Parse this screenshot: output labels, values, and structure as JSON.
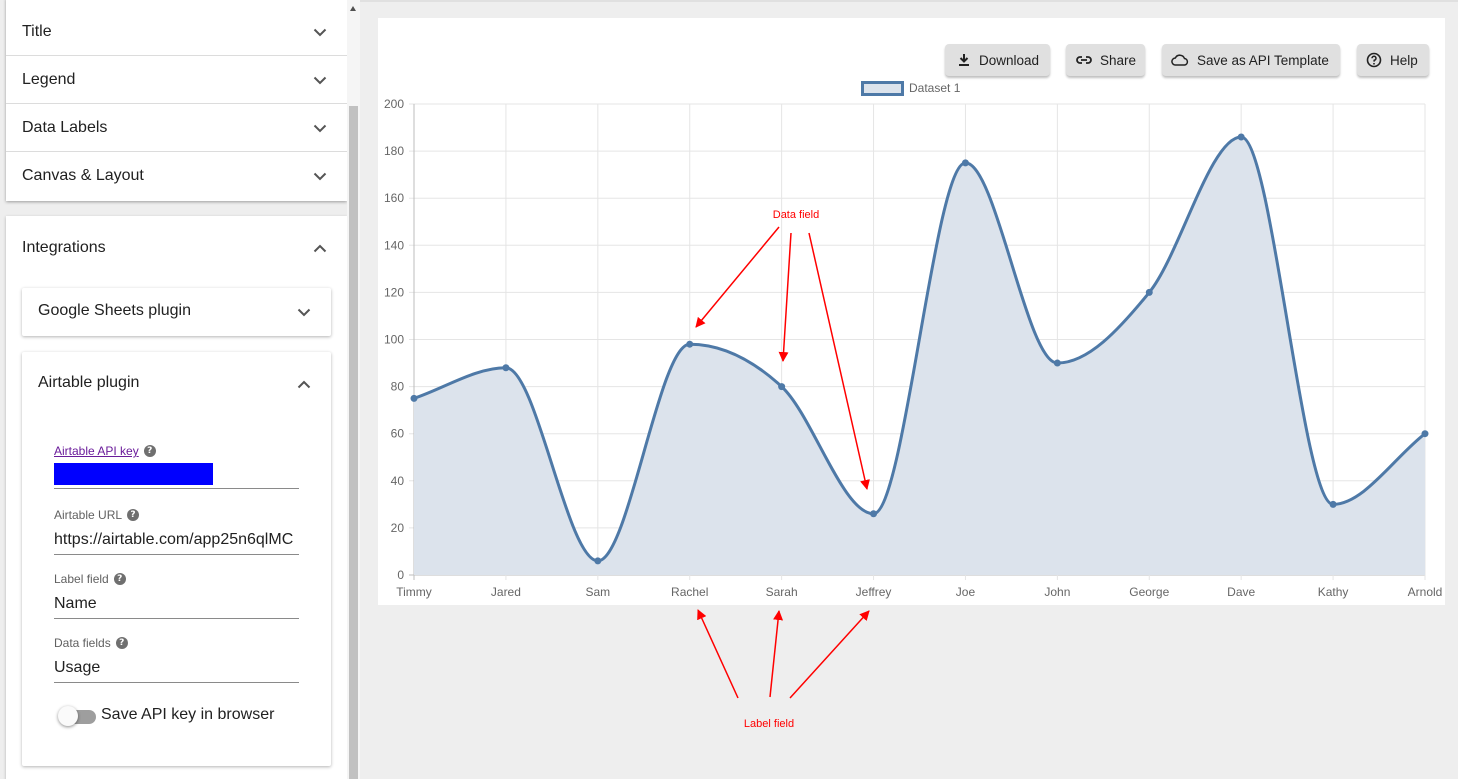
{
  "sidebar": {
    "sections": [
      {
        "label": "Title"
      },
      {
        "label": "Legend"
      },
      {
        "label": "Data Labels"
      },
      {
        "label": "Canvas & Layout"
      }
    ],
    "integrations": {
      "label": "Integrations",
      "google_sheets": {
        "label": "Google Sheets plugin"
      },
      "airtable": {
        "label": "Airtable plugin",
        "api_key_label": "Airtable API key",
        "url_label": "Airtable URL",
        "url_value": "https://airtable.com/app25n6qlMC",
        "label_field_label": "Label field",
        "label_field_value": "Name",
        "data_fields_label": "Data fields",
        "data_fields_value": "Usage",
        "save_key_label": "Save API key in browser",
        "save_key_on": false
      }
    }
  },
  "toolbar": {
    "download": "Download",
    "share": "Share",
    "save_template": "Save as API Template",
    "help": "Help"
  },
  "chart_data": {
    "type": "line",
    "smooth": true,
    "filled": true,
    "categories": [
      "Timmy",
      "Jared",
      "Sam",
      "Rachel",
      "Sarah",
      "Jeffrey",
      "Joe",
      "John",
      "George",
      "Dave",
      "Kathy",
      "Arnold"
    ],
    "series": [
      {
        "name": "Dataset 1",
        "values": [
          75,
          88,
          6,
          98,
          80,
          26,
          175,
          90,
          120,
          186,
          30,
          60
        ],
        "color": "#4e79a7",
        "fill": "#dce3ec"
      }
    ],
    "ylim": [
      0,
      200
    ],
    "yticks": [
      0,
      20,
      40,
      60,
      80,
      100,
      120,
      140,
      160,
      180,
      200
    ],
    "grid": true,
    "legend": "top-center"
  },
  "annotations": {
    "data_field": "Data field",
    "label_field": "Label field",
    "color": "#ff0000"
  }
}
